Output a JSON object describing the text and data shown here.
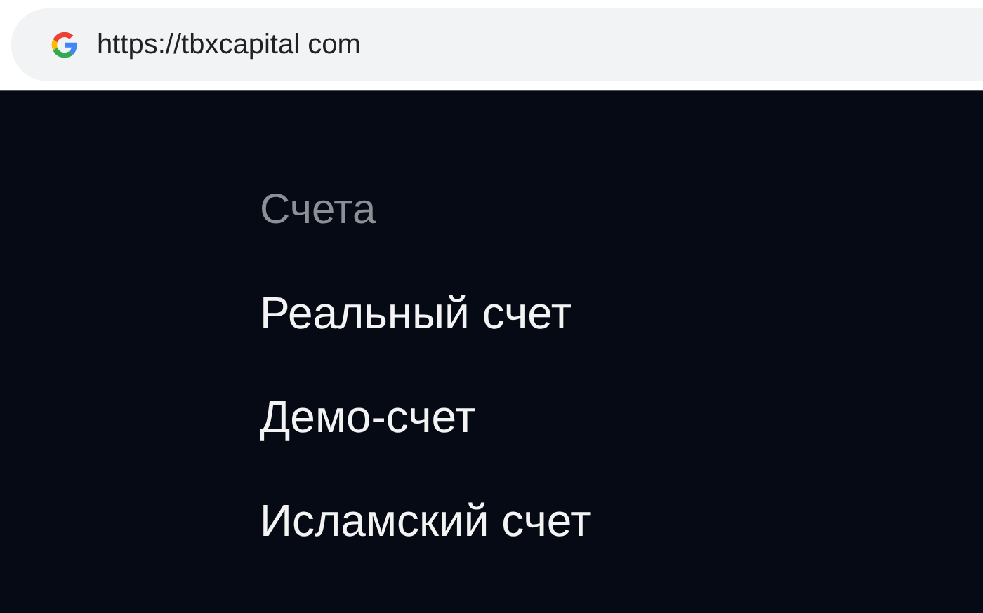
{
  "browser": {
    "url": "https://tbxcapital com"
  },
  "menu": {
    "heading": "Счета",
    "items": [
      {
        "label": "Реальный счет"
      },
      {
        "label": "Демо-счет"
      },
      {
        "label": "Исламский счет"
      }
    ]
  }
}
